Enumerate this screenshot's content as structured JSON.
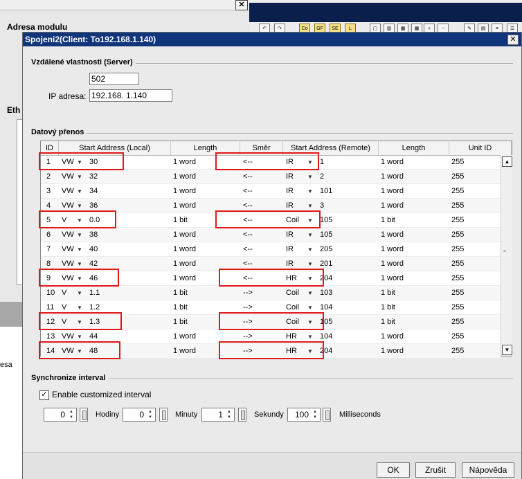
{
  "background": {
    "left_section_title": "Adresa modulu",
    "left_eth_label": "Eth",
    "left_partial_label": "esa",
    "close_glyph": "✕",
    "toolbar_labels": [
      "Co",
      "GF",
      "SE",
      "L"
    ]
  },
  "dialog": {
    "title": "Spojeni2(Client: To192.168.1.140)",
    "close_glyph": "✕",
    "server_group": {
      "title": "Vzdálené vlastnosti (Server)",
      "port_value": "502",
      "ip_label": "IP adresa:",
      "ip_value": "192.168.  1.140"
    },
    "transfer_group": {
      "title": "Datový přenos",
      "columns": [
        "ID",
        "Start Address (Local)",
        "Length",
        "Směr",
        "Start Address (Remote)",
        "Length",
        "Unit ID"
      ],
      "dropdown_glyph": "▼",
      "rows": [
        {
          "id": "1",
          "local_type": "VW",
          "local_addr": "30",
          "length": "1 word",
          "dir": "<--",
          "remote_type": "IR",
          "remote_addr": "1",
          "rlength": "1 word",
          "unit": "255",
          "highlight": true
        },
        {
          "id": "2",
          "local_type": "VW",
          "local_addr": "32",
          "length": "1 word",
          "dir": "<--",
          "remote_type": "IR",
          "remote_addr": "2",
          "rlength": "1 word",
          "unit": "255",
          "highlight": false
        },
        {
          "id": "3",
          "local_type": "VW",
          "local_addr": "34",
          "length": "1 word",
          "dir": "<--",
          "remote_type": "IR",
          "remote_addr": "101",
          "rlength": "1 word",
          "unit": "255",
          "highlight": false
        },
        {
          "id": "4",
          "local_type": "VW",
          "local_addr": "36",
          "length": "1 word",
          "dir": "<--",
          "remote_type": "IR",
          "remote_addr": "3",
          "rlength": "1 word",
          "unit": "255",
          "highlight": false
        },
        {
          "id": "5",
          "local_type": "V",
          "local_addr": "0.0",
          "length": "1 bit",
          "dir": "<--",
          "remote_type": "Coil",
          "remote_addr": "105",
          "rlength": "1 bit",
          "unit": "255",
          "highlight": true
        },
        {
          "id": "6",
          "local_type": "VW",
          "local_addr": "38",
          "length": "1 word",
          "dir": "<--",
          "remote_type": "IR",
          "remote_addr": "105",
          "rlength": "1 word",
          "unit": "255",
          "highlight": false
        },
        {
          "id": "7",
          "local_type": "VW",
          "local_addr": "40",
          "length": "1 word",
          "dir": "<--",
          "remote_type": "IR",
          "remote_addr": "205",
          "rlength": "1 word",
          "unit": "255",
          "highlight": false
        },
        {
          "id": "8",
          "local_type": "VW",
          "local_addr": "42",
          "length": "1 word",
          "dir": "<--",
          "remote_type": "IR",
          "remote_addr": "201",
          "rlength": "1 word",
          "unit": "255",
          "highlight": false
        },
        {
          "id": "9",
          "local_type": "VW",
          "local_addr": "46",
          "length": "1 word",
          "dir": "<--",
          "remote_type": "HR",
          "remote_addr": "204",
          "rlength": "1 word",
          "unit": "255",
          "highlight": true
        },
        {
          "id": "10",
          "local_type": "V",
          "local_addr": "1.1",
          "length": "1 bit",
          "dir": "-->",
          "remote_type": "Coil",
          "remote_addr": "103",
          "rlength": "1 bit",
          "unit": "255",
          "highlight": false
        },
        {
          "id": "11",
          "local_type": "V",
          "local_addr": "1.2",
          "length": "1 bit",
          "dir": "-->",
          "remote_type": "Coil",
          "remote_addr": "104",
          "rlength": "1 bit",
          "unit": "255",
          "highlight": false
        },
        {
          "id": "12",
          "local_type": "V",
          "local_addr": "1.3",
          "length": "1 bit",
          "dir": "-->",
          "remote_type": "Coil",
          "remote_addr": "105",
          "rlength": "1 bit",
          "unit": "255",
          "highlight": true
        },
        {
          "id": "13",
          "local_type": "VW",
          "local_addr": "44",
          "length": "1 word",
          "dir": "-->",
          "remote_type": "HR",
          "remote_addr": "104",
          "rlength": "1 word",
          "unit": "255",
          "highlight": false
        },
        {
          "id": "14",
          "local_type": "VW",
          "local_addr": "48",
          "length": "1 word",
          "dir": "-->",
          "remote_type": "HR",
          "remote_addr": "204",
          "rlength": "1 word",
          "unit": "255",
          "highlight": true
        }
      ]
    },
    "sync_group": {
      "title": "Synchronize interval",
      "checkbox_label": "Enable customized interval",
      "checkbox_checked": true,
      "check_glyph": "✓",
      "hours_value": "0",
      "hours_label": "Hodiny",
      "minutes_value": "0",
      "minutes_label": "Minuty",
      "seconds_value": "1",
      "seconds_label": "Sekundy",
      "ms_value": "100",
      "ms_label": "Milliseconds"
    },
    "buttons": {
      "ok": "OK",
      "cancel": "Zrušit",
      "help": "Nápověda"
    }
  },
  "colors": {
    "title_bar": "#10357a",
    "highlight": "#e01818"
  }
}
